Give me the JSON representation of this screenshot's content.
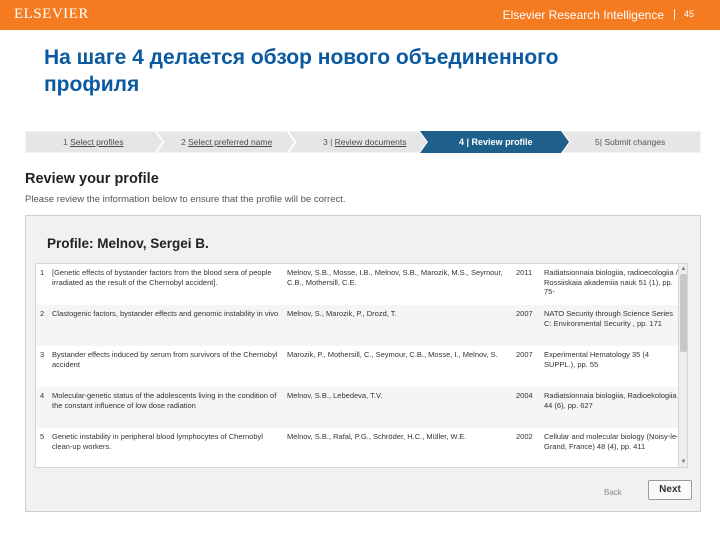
{
  "header": {
    "logo": "ELSEVIER",
    "brand": "Elsevier Research Intelligence",
    "separator": "|",
    "page_number": "45"
  },
  "slide": {
    "title_line1": "На шаге 4 делается обзор нового объединенного",
    "title_line2": "профиля"
  },
  "steps": [
    {
      "number": "1",
      "label": "Select profiles"
    },
    {
      "number": "2",
      "label": "Select preferred name"
    },
    {
      "number": "3",
      "label": "Review documents"
    },
    {
      "number": "4",
      "label": "Review profile"
    },
    {
      "number": "5",
      "label": "Submit changes"
    }
  ],
  "active_step": 4,
  "review": {
    "heading": "Review your profile",
    "description": "Please review the information below to ensure that the profile will be correct."
  },
  "profile": {
    "name": "Profile: Melnov, Sergei B.",
    "rows": [
      {
        "num": "1",
        "title": "[Genetic effects of bystander factors from the blood sera of people irradiated as the result of the Chernobyl accident].",
        "authors": "Melnov, S.B., Mosse, I.B., Melnov, S.B., Marozik, M.S., Seymour, C.B., Mothersill, C.E.",
        "year": "2011",
        "source": "Radiatsionnaia biologiia, radioecologiia / Rossiiskaia akademiia nauk 51 (1), pp. 75-"
      },
      {
        "num": "2",
        "title": "Clastogenic factors, bystander effects and genomic instability in vivo",
        "authors": "Melnov, S., Marozik, P., Drozd, T.",
        "year": "2007",
        "source": "NATO Security through Science Series C: Environmental Security , pp. 171"
      },
      {
        "num": "3",
        "title": "Bystander effects induced by serum from survivors of the Chernobyl accident",
        "authors": "Marozik, P., Mothersill, C., Seymour, C.B., Mosse, I., Melnov, S.",
        "year": "2007",
        "source": "Experimental Hematology 35 (4 SUPPL.), pp. 55"
      },
      {
        "num": "4",
        "title": "Molecular-genetic status of the adolescents living in the condition of the constant influence of low dose radiation",
        "authors": "Melnov, S.B., Lebedeva, T.V.",
        "year": "2004",
        "source": "Radiatsionnaia biologiia, Radioekologiia 44 (6), pp. 627"
      },
      {
        "num": "5",
        "title": "Genetic instability in peripheral blood lymphocytes of Chernobyl clean-up workers.",
        "authors": "Melnov, S.B., Rafal, P.G., Schröder, H.C., Müller, W.E.",
        "year": "2002",
        "source": "Cellular and molecular biology (Noisy-le-Grand, France) 48 (4), pp. 411"
      }
    ],
    "back_label": "Back",
    "next_label": "Next"
  },
  "colors": {
    "header_orange": "#f47b20",
    "title_blue": "#0b5aa0",
    "active_step": "#1f5f8b"
  }
}
